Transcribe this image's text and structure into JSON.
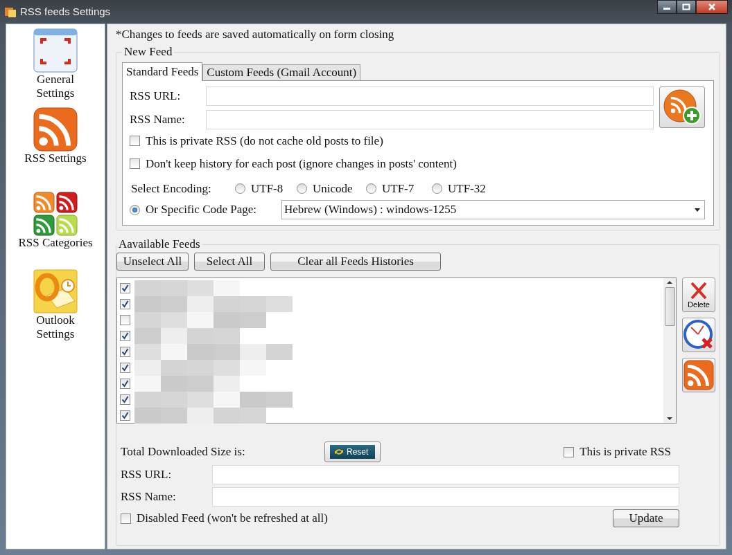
{
  "window": {
    "title": "RSS feeds Settings"
  },
  "sidebar": {
    "items": [
      {
        "kind": "general",
        "label": "General Settings"
      },
      {
        "kind": "rss",
        "label": "RSS Settings"
      },
      {
        "kind": "categories",
        "label": "RSS Categories"
      },
      {
        "kind": "outlook",
        "label": "Outlook Settings"
      }
    ]
  },
  "notice": "*Changes to feeds are saved automatically on form closing",
  "new_feed": {
    "title": "New Feed",
    "tabs": [
      {
        "label": "Standard Feeds",
        "selected": true
      },
      {
        "label": "Custom Feeds (Gmail Account)",
        "selected": false
      }
    ],
    "fields": [
      {
        "label": "RSS URL:"
      },
      {
        "label": "RSS Name:"
      }
    ],
    "options": [
      {
        "label": "This is private RSS (do not cache old posts to file)",
        "checked": false
      },
      {
        "label": "Don't keep history for each post (ignore changes in posts' content)",
        "checked": false
      }
    ],
    "encoding_label": "Select Encoding:",
    "encodings": [
      {
        "label": "UTF-8",
        "selected": false
      },
      {
        "label": "Unicode",
        "selected": false
      },
      {
        "label": "UTF-7",
        "selected": false
      },
      {
        "label": "UTF-32",
        "selected": false
      }
    ],
    "code_page": {
      "label": "Or Specific Code Page:",
      "selected": true,
      "value": "Hebrew (Windows) : windows-1255"
    }
  },
  "available_feeds": {
    "title": "Aavailable Feeds",
    "buttons": [
      "Unselect All",
      "Select All",
      "Clear all Feeds Histories"
    ],
    "feeds": [
      {
        "checked": true
      },
      {
        "checked": true
      },
      {
        "checked": false
      },
      {
        "checked": true
      },
      {
        "checked": true
      },
      {
        "checked": true
      },
      {
        "checked": true
      },
      {
        "checked": true
      },
      {
        "checked": true
      }
    ],
    "side_buttons": [
      {
        "kind": "delete",
        "label": "Delete"
      },
      {
        "kind": "clock"
      },
      {
        "kind": "rss"
      }
    ]
  },
  "details": {
    "size_label": "Total Downloaded Size is:",
    "reset_button": "Reset",
    "private": {
      "label": "This is private RSS",
      "checked": false
    },
    "fields": [
      {
        "label": "RSS URL:"
      },
      {
        "label": "RSS Name:"
      }
    ],
    "disabled": {
      "label": "Disabled Feed (won't be refreshed at all)",
      "checked": false
    },
    "update_button": "Update"
  }
}
